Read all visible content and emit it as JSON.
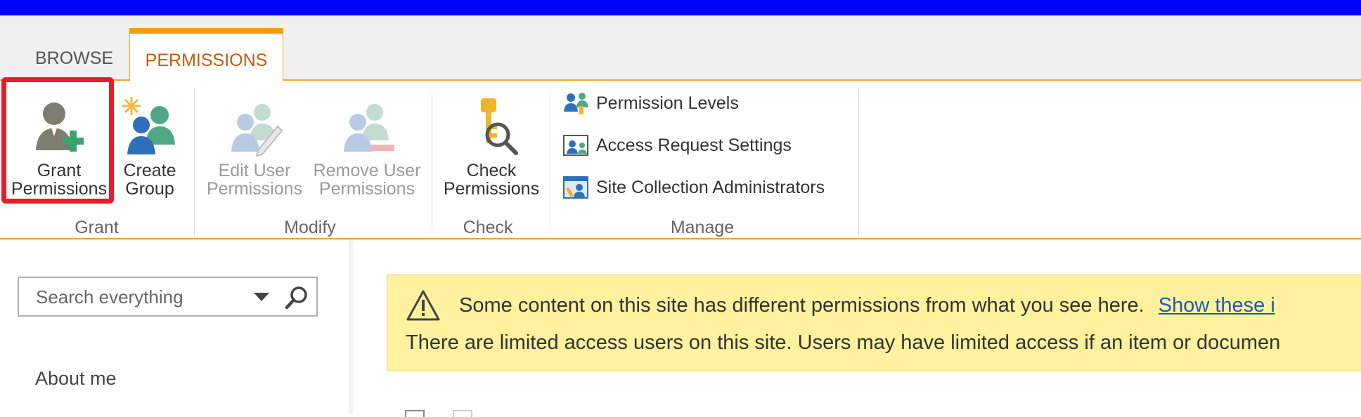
{
  "tabs": [
    {
      "label": "BROWSE",
      "active": false
    },
    {
      "label": "PERMISSIONS",
      "active": true
    }
  ],
  "ribbon": {
    "grant": {
      "grant_permissions": "Grant Permissions",
      "create_group": "Create Group",
      "label": "Grant"
    },
    "modify": {
      "edit_user_permissions": "Edit User Permissions",
      "remove_user_permissions": "Remove User Permissions",
      "label": "Modify"
    },
    "check": {
      "check_permissions": "Check Permissions",
      "label": "Check"
    },
    "manage": {
      "permission_levels": "Permission Levels",
      "access_request_settings": "Access Request Settings",
      "site_collection_administrators": "Site Collection Administrators",
      "label": "Manage"
    }
  },
  "search": {
    "placeholder": "Search everything"
  },
  "nav": {
    "about_me": "About me"
  },
  "notice": {
    "line1": "Some content on this site has different permissions from what you see here.",
    "line1_link": "Show these i",
    "line2": "There are limited access users on this site. Users may have limited access if an item or documen"
  },
  "colors": {
    "top_bar": "#0000ff",
    "accent": "#f39c12",
    "active_tab_text": "#c35a0e",
    "highlight": "#e81c2a",
    "notice_bg": "#fff19e",
    "link": "#1a5db4"
  }
}
